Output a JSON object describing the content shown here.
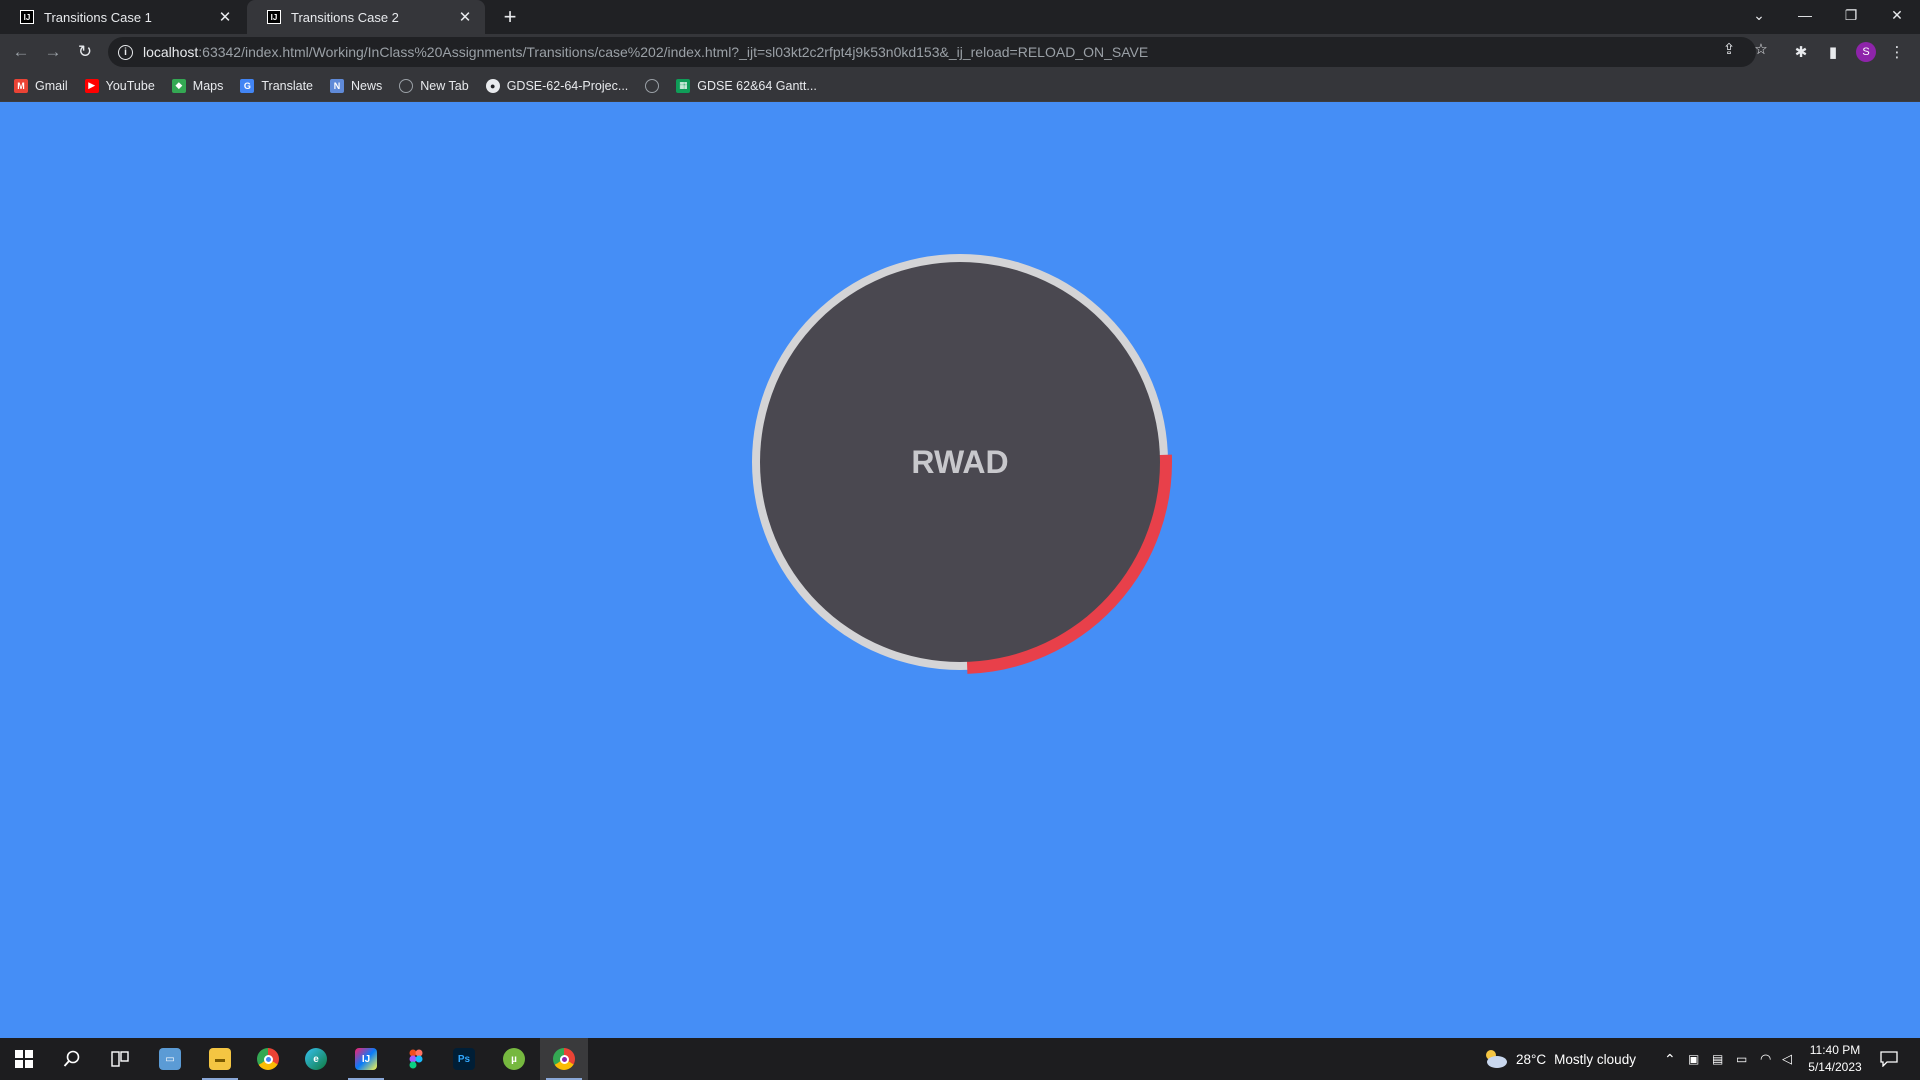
{
  "browser": {
    "tabs": [
      {
        "title": "Transitions Case 1",
        "active": false
      },
      {
        "title": "Transitions Case 2",
        "active": true
      }
    ],
    "url_host": "localhost",
    "url_rest": ":63342/index.html/Working/InClass%20Assignments/Transitions/case%202/index.html?_ijt=sl03kt2c2rfpt4j9k53n0kd153&_ij_reload=RELOAD_ON_SAVE",
    "profile_initial": "S",
    "bookmarks": [
      {
        "label": "Gmail",
        "icon": "gmail-icon",
        "color": "#ea4335"
      },
      {
        "label": "YouTube",
        "icon": "youtube-icon",
        "color": "#ff0000"
      },
      {
        "label": "Maps",
        "icon": "maps-icon",
        "color": "#34a853"
      },
      {
        "label": "Translate",
        "icon": "translate-icon",
        "color": "#4285f4"
      },
      {
        "label": "News",
        "icon": "news-icon",
        "color": "#5f8ad8"
      },
      {
        "label": "New Tab",
        "icon": "globe-icon",
        "color": "#9aa0a6"
      },
      {
        "label": "GDSE-62-64-Projec...",
        "icon": "github-icon",
        "color": "#e8eaed"
      },
      {
        "label": "",
        "icon": "globe-icon",
        "color": "#9aa0a6"
      },
      {
        "label": "GDSE 62&64 Gantt...",
        "icon": "sheets-icon",
        "color": "#0f9d58"
      }
    ]
  },
  "page": {
    "background": "#458ef6",
    "circle_label": "RWAD",
    "circle_fill": "#4a4850",
    "ring_color": "#d4d4d6",
    "progress_color": "#e8404a",
    "progress_fraction": 0.25
  },
  "taskbar": {
    "weather_temp": "28°C",
    "weather_desc": "Mostly cloudy",
    "time": "11:40 PM",
    "date": "5/14/2023"
  }
}
